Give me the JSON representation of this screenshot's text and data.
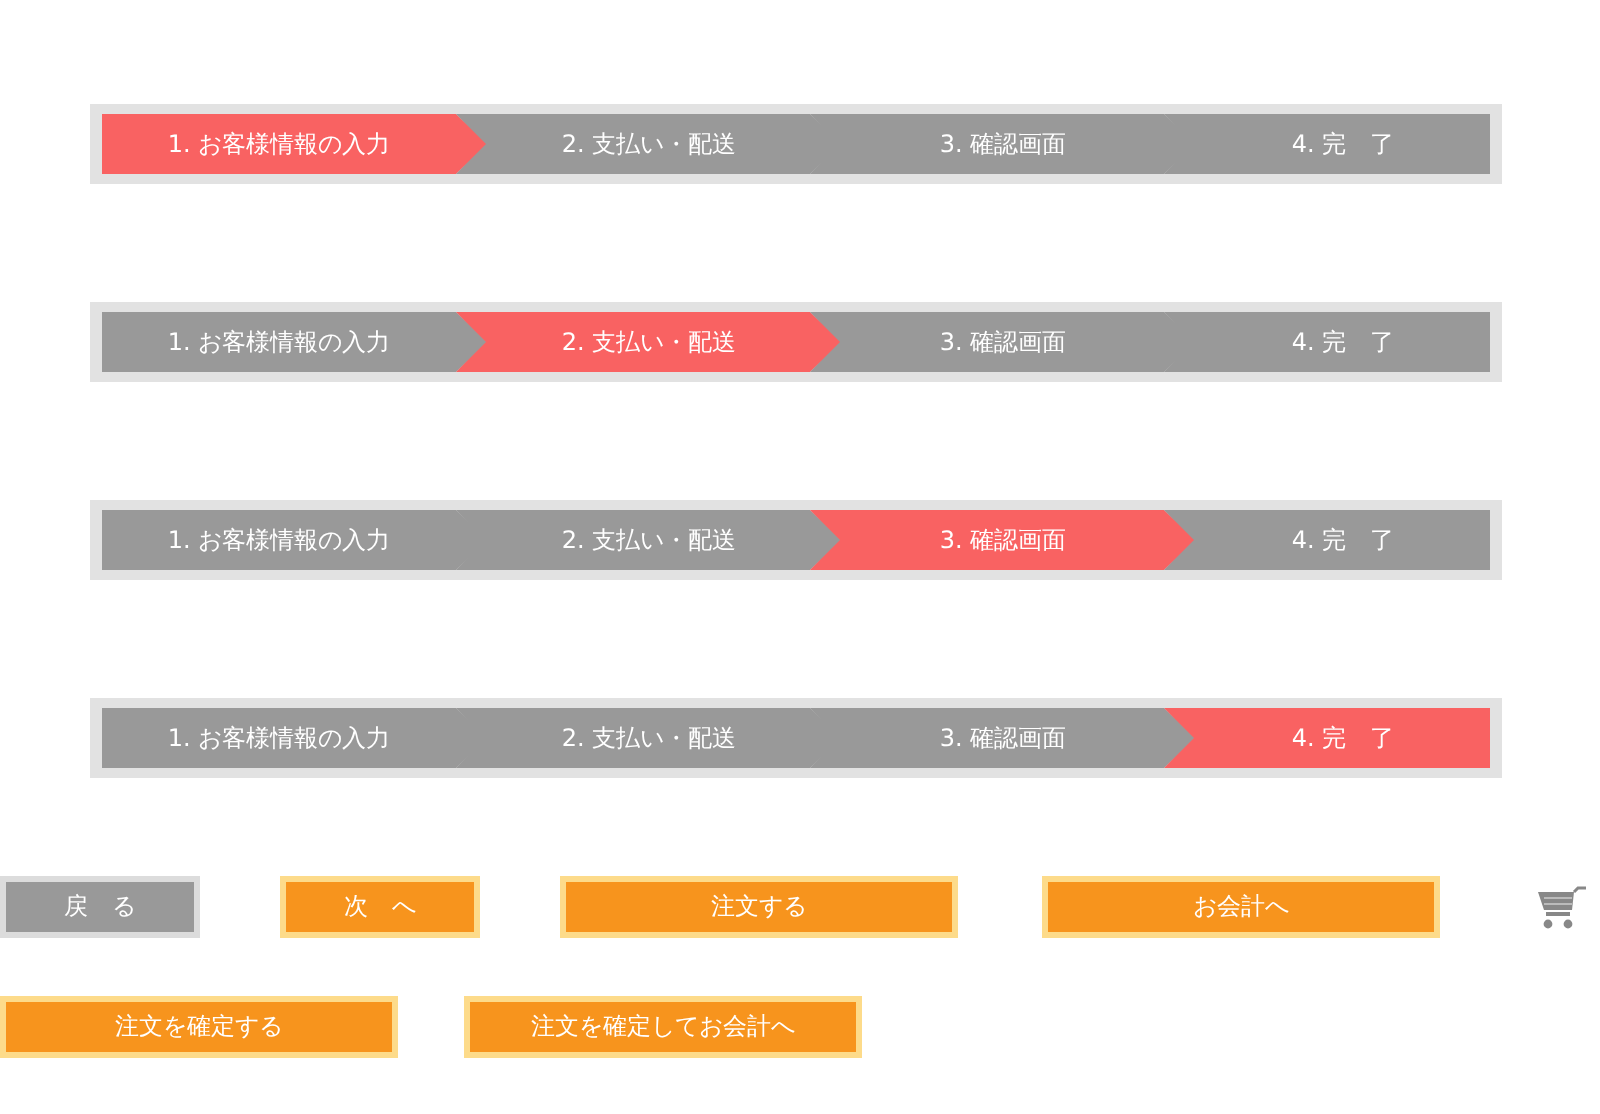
{
  "progress_bars": [
    {
      "steps": [
        {
          "label": "1. お客様情報の入力",
          "selected": true
        },
        {
          "label": "2. 支払い・配送",
          "selected": false
        },
        {
          "label": "3. 確認画面",
          "selected": false
        },
        {
          "label": "4. 完　了",
          "selected": false
        }
      ]
    },
    {
      "steps": [
        {
          "label": "1. お客様情報の入力",
          "selected": false
        },
        {
          "label": "2. 支払い・配送",
          "selected": true
        },
        {
          "label": "3. 確認画面",
          "selected": false
        },
        {
          "label": "4. 完　了",
          "selected": false
        }
      ]
    },
    {
      "steps": [
        {
          "label": "1. お客様情報の入力",
          "selected": false
        },
        {
          "label": "2. 支払い・配送",
          "selected": false
        },
        {
          "label": "3. 確認画面",
          "selected": true
        },
        {
          "label": "4. 完　了",
          "selected": false
        }
      ]
    },
    {
      "steps": [
        {
          "label": "1. お客様情報の入力",
          "selected": false
        },
        {
          "label": "2. 支払い・配送",
          "selected": false
        },
        {
          "label": "3. 確認画面",
          "selected": false
        },
        {
          "label": "4. 完　了",
          "selected": true
        }
      ]
    }
  ],
  "button_rows": [
    {
      "buttons": [
        {
          "label": "戻　る",
          "kind": "secondary"
        },
        {
          "label": "次　へ",
          "kind": "primary"
        },
        {
          "label": "注文する",
          "kind": "primary"
        },
        {
          "label": "お会計へ",
          "kind": "primary"
        },
        {
          "kind": "cart"
        }
      ]
    },
    {
      "buttons": [
        {
          "label": "注文を確定する",
          "kind": "primary"
        },
        {
          "label": "注文を確定してお会計へ",
          "kind": "primary"
        }
      ]
    }
  ]
}
